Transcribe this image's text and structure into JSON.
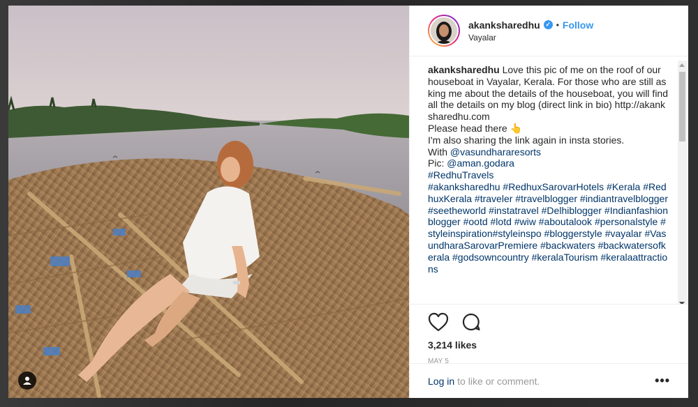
{
  "post": {
    "username": "akanksharedhu",
    "verified_badge": "verified-check-icon",
    "separator": "•",
    "follow_label": "Follow",
    "location": "Vayalar"
  },
  "caption": {
    "username": "akanksharedhu",
    "text_1": " Love this pic of me on the roof of our houseboat in Vayalar, Kerala. For those who are still asking me about the details of the houseboat, you will find all the details on my blog (direct link in bio) http://akanksharedhu.com",
    "text_2": "Please head there 👆",
    "text_3": "I'm also sharing the link again in insta stories.",
    "with_prefix": "With ",
    "with_link": "@vasundhararesorts",
    "pic_prefix": "Pic: ",
    "pic_link": "@aman.godara",
    "tags_1": "#RedhuTravels",
    "tags_2": "#akanksharedhu #RedhuxSarovarHotels #Kerala #RedhuxKerala #traveler #travelblogger #indiantravelblogger #seetheworld #instatravel #Delhiblogger #Indianfashionblogger #ootd #lotd #wiw #aboutalook #personalstyle #styleinspiration#styleinspo #bloggerstyle #vayalar #VasundharaSarovarPremiere #backwaters #backwatersofkerala #godsowncountry #keralaTourism #keralaattractions"
  },
  "actions": {
    "like_icon": "heart-icon",
    "comment_icon": "comment-icon",
    "likes_text": "3,214 likes",
    "date": "MAY 5"
  },
  "footer": {
    "login_label": "Log in",
    "rest_text": "to like or comment.",
    "more_label": "•••"
  },
  "colors": {
    "accent": "#3897f0",
    "link": "#003569",
    "text": "#262626",
    "muted": "#999999"
  }
}
